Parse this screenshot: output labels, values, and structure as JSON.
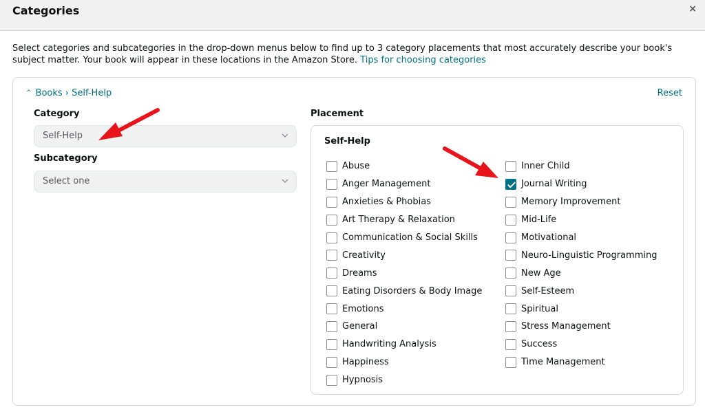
{
  "header": {
    "title": "Categories",
    "close_symbol": "×"
  },
  "description": {
    "text": "Select categories and subcategories in the drop-down menus below to find up to 3 category placements that most accurately describe your book's subject matter. Your book will appear in these locations in the Amazon Store.",
    "tips_link": "Tips for choosing categories"
  },
  "panel": {
    "breadcrumb": "Books › Self-Help",
    "reset_label": "Reset",
    "category_label": "Category",
    "category_value": "Self-Help",
    "subcategory_label": "Subcategory",
    "subcategory_placeholder": "Select one",
    "placement_label": "Placement",
    "placement_heading": "Self-Help",
    "left_items": [
      {
        "label": "Abuse",
        "checked": false
      },
      {
        "label": "Anger Management",
        "checked": false
      },
      {
        "label": "Anxieties & Phobias",
        "checked": false
      },
      {
        "label": "Art Therapy & Relaxation",
        "checked": false
      },
      {
        "label": "Communication & Social Skills",
        "checked": false
      },
      {
        "label": "Creativity",
        "checked": false
      },
      {
        "label": "Dreams",
        "checked": false
      },
      {
        "label": "Eating Disorders & Body Image",
        "checked": false
      },
      {
        "label": "Emotions",
        "checked": false
      },
      {
        "label": "General",
        "checked": false
      },
      {
        "label": "Handwriting Analysis",
        "checked": false
      },
      {
        "label": "Happiness",
        "checked": false
      },
      {
        "label": "Hypnosis",
        "checked": false
      }
    ],
    "right_items": [
      {
        "label": "Inner Child",
        "checked": false
      },
      {
        "label": "Journal Writing",
        "checked": true
      },
      {
        "label": "Memory Improvement",
        "checked": false
      },
      {
        "label": "Mid-Life",
        "checked": false
      },
      {
        "label": "Motivational",
        "checked": false
      },
      {
        "label": "Neuro-Linguistic Programming",
        "checked": false
      },
      {
        "label": "New Age",
        "checked": false
      },
      {
        "label": "Self-Esteem",
        "checked": false
      },
      {
        "label": "Spiritual",
        "checked": false
      },
      {
        "label": "Stress Management",
        "checked": false
      },
      {
        "label": "Success",
        "checked": false
      },
      {
        "label": "Time Management",
        "checked": false
      }
    ]
  },
  "colors": {
    "link": "#007185",
    "checkbox_checked": "#007185",
    "annotation_arrow": "#e8141b"
  }
}
